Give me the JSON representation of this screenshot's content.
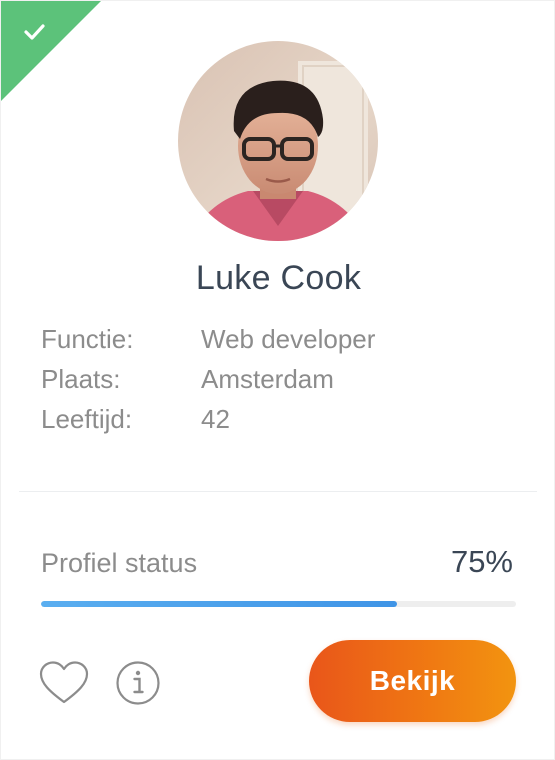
{
  "profile": {
    "name": "Luke Cook",
    "verified": true
  },
  "details": [
    {
      "label": "Functie:",
      "value": "Web developer"
    },
    {
      "label": "Plaats:",
      "value": "Amsterdam"
    },
    {
      "label": "Leeftijd:",
      "value": "42"
    }
  ],
  "status": {
    "label": "Profiel status",
    "percent_text": "75%",
    "progress": 0.75
  },
  "actions": {
    "view_label": "Bekijk",
    "favorite_icon": "heart-icon",
    "info_icon": "info-icon"
  },
  "colors": {
    "verified_ribbon": "#5cc27a",
    "progress_fill": "#4a9fe9",
    "cta_gradient_start": "#e9561a",
    "cta_gradient_end": "#f29410",
    "name_text": "#3a4655"
  }
}
